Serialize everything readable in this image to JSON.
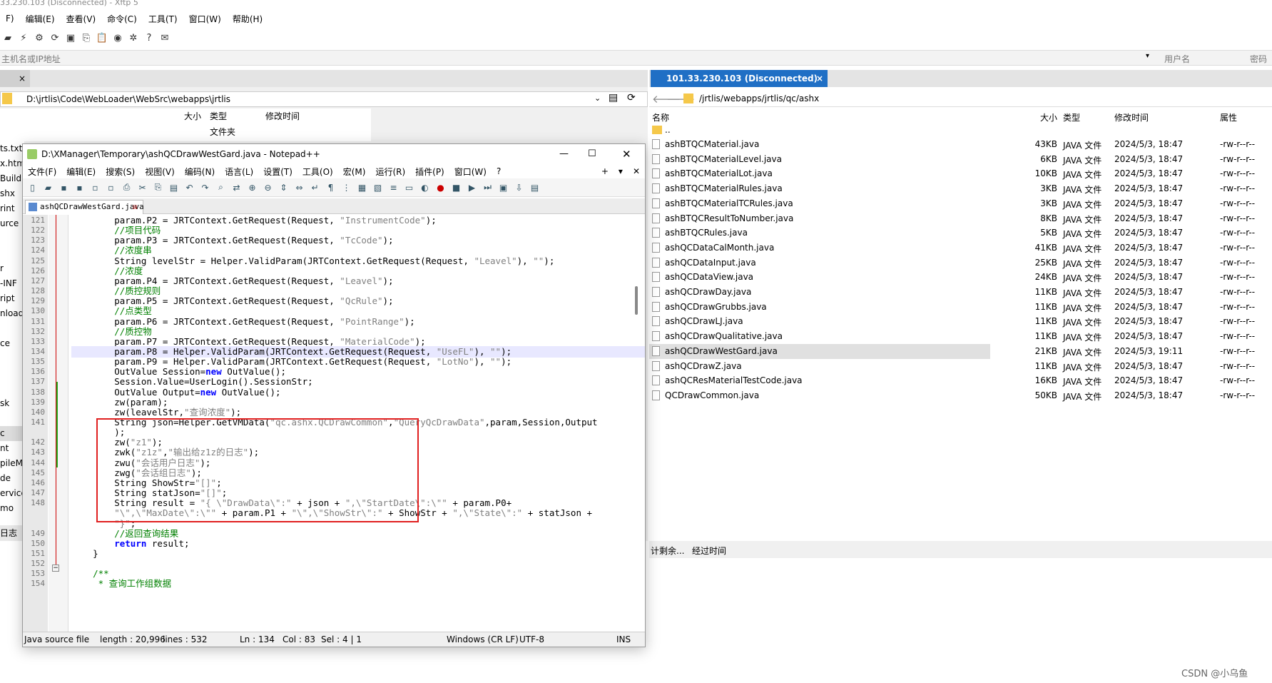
{
  "app": {
    "title": "33.230.103 (Disconnected)    - Xftp 5"
  },
  "menu": [
    "F)",
    "编辑(E)",
    "查看(V)",
    "命令(C)",
    "工具(T)",
    "窗口(W)",
    "帮助(H)"
  ],
  "addr": {
    "host_placeholder": "主机名或IP地址",
    "user_label": "用户名",
    "pass_label": "密码"
  },
  "left": {
    "path": "D:\\jrtlis\\Code\\WebLoader\\WebSrc\\webapps\\jrtlis",
    "col_size": "大小",
    "col_type": "类型",
    "col_time": "修改时间",
    "first_type": "文件夹",
    "items": [
      "ts.txt",
      "x.html",
      "Build",
      "shx",
      "rint",
      "urce",
      "",
      "",
      "r",
      "-INF",
      "ript",
      "nload",
      "",
      "ce",
      "",
      "",
      "",
      "sk",
      "",
      "c",
      "nt",
      "pileM",
      "de",
      "ervice",
      "mo"
    ],
    "footer_label": "日志"
  },
  "right": {
    "tab": "101.33.230.103 (Disconnected)",
    "path": "/jrtlis/webapps/jrtlis/qc/ashx",
    "col_name": "名称",
    "col_size": "大小",
    "col_type": "类型",
    "col_time": "修改时间",
    "col_attr": "属性",
    "up": "..",
    "files": [
      {
        "name": "ashBTQCMaterial.java",
        "size": "43KB",
        "type": "JAVA 文件",
        "time": "2024/5/3, 18:47",
        "attr": "-rw-r--r--"
      },
      {
        "name": "ashBTQCMaterialLevel.java",
        "size": "6KB",
        "type": "JAVA 文件",
        "time": "2024/5/3, 18:47",
        "attr": "-rw-r--r--"
      },
      {
        "name": "ashBTQCMaterialLot.java",
        "size": "10KB",
        "type": "JAVA 文件",
        "time": "2024/5/3, 18:47",
        "attr": "-rw-r--r--"
      },
      {
        "name": "ashBTQCMaterialRules.java",
        "size": "3KB",
        "type": "JAVA 文件",
        "time": "2024/5/3, 18:47",
        "attr": "-rw-r--r--"
      },
      {
        "name": "ashBTQCMaterialTCRules.java",
        "size": "3KB",
        "type": "JAVA 文件",
        "time": "2024/5/3, 18:47",
        "attr": "-rw-r--r--"
      },
      {
        "name": "ashBTQCResultToNumber.java",
        "size": "8KB",
        "type": "JAVA 文件",
        "time": "2024/5/3, 18:47",
        "attr": "-rw-r--r--"
      },
      {
        "name": "ashBTQCRules.java",
        "size": "5KB",
        "type": "JAVA 文件",
        "time": "2024/5/3, 18:47",
        "attr": "-rw-r--r--"
      },
      {
        "name": "ashQCDataCalMonth.java",
        "size": "41KB",
        "type": "JAVA 文件",
        "time": "2024/5/3, 18:47",
        "attr": "-rw-r--r--"
      },
      {
        "name": "ashQCDataInput.java",
        "size": "25KB",
        "type": "JAVA 文件",
        "time": "2024/5/3, 18:47",
        "attr": "-rw-r--r--"
      },
      {
        "name": "ashQCDataView.java",
        "size": "24KB",
        "type": "JAVA 文件",
        "time": "2024/5/3, 18:47",
        "attr": "-rw-r--r--"
      },
      {
        "name": "ashQCDrawDay.java",
        "size": "11KB",
        "type": "JAVA 文件",
        "time": "2024/5/3, 18:47",
        "attr": "-rw-r--r--"
      },
      {
        "name": "ashQCDrawGrubbs.java",
        "size": "11KB",
        "type": "JAVA 文件",
        "time": "2024/5/3, 18:47",
        "attr": "-rw-r--r--"
      },
      {
        "name": "ashQCDrawLJ.java",
        "size": "11KB",
        "type": "JAVA 文件",
        "time": "2024/5/3, 18:47",
        "attr": "-rw-r--r--"
      },
      {
        "name": "ashQCDrawQualitative.java",
        "size": "11KB",
        "type": "JAVA 文件",
        "time": "2024/5/3, 18:47",
        "attr": "-rw-r--r--"
      },
      {
        "name": "ashQCDrawWestGard.java",
        "size": "21KB",
        "type": "JAVA 文件",
        "time": "2024/5/3, 19:11",
        "attr": "-rw-r--r--",
        "selected": true
      },
      {
        "name": "ashQCDrawZ.java",
        "size": "11KB",
        "type": "JAVA 文件",
        "time": "2024/5/3, 18:47",
        "attr": "-rw-r--r--"
      },
      {
        "name": "ashQCResMaterialTestCode.java",
        "size": "16KB",
        "type": "JAVA 文件",
        "time": "2024/5/3, 18:47",
        "attr": "-rw-r--r--"
      },
      {
        "name": "QCDrawCommon.java",
        "size": "50KB",
        "type": "JAVA 文件",
        "time": "2024/5/3, 18:47",
        "attr": "-rw-r--r--"
      }
    ],
    "bottom_tabs": [
      "计剩余...",
      "经过时间"
    ]
  },
  "notepad": {
    "title": "D:\\XManager\\Temporary\\ashQCDrawWestGard.java - Notepad++",
    "menu": [
      "文件(F)",
      "编辑(E)",
      "搜索(S)",
      "视图(V)",
      "编码(N)",
      "语言(L)",
      "设置(T)",
      "工具(O)",
      "宏(M)",
      "运行(R)",
      "插件(P)",
      "窗口(W)",
      "?"
    ],
    "tab": "ashQCDrawWestGard.java",
    "status": {
      "type": "Java source file",
      "length": "length : 20,996",
      "lines": "lines : 532",
      "ln": "Ln : 134",
      "col": "Col : 83",
      "sel": "Sel : 4 | 1",
      "eol": "Windows (CR LF)",
      "enc": "UTF-8",
      "ins": "INS"
    },
    "lines": [
      {
        "n": "121",
        "t": "        param.P2 = JRTContext.GetRequest(Request, \"InstrumentCode\");"
      },
      {
        "n": "122",
        "t": "        //项目代码",
        "c": "cm"
      },
      {
        "n": "123",
        "t": "        param.P3 = JRTContext.GetRequest(Request, \"TcCode\");"
      },
      {
        "n": "124",
        "t": "        //浓度串",
        "c": "cm"
      },
      {
        "n": "125",
        "t": "        String levelStr = Helper.ValidParam(JRTContext.GetRequest(Request, \"Leavel\"), \"\");"
      },
      {
        "n": "126",
        "t": "        //浓度",
        "c": "cm"
      },
      {
        "n": "127",
        "t": "        param.P4 = JRTContext.GetRequest(Request, \"Leavel\");"
      },
      {
        "n": "128",
        "t": "        //质控规则",
        "c": "cm"
      },
      {
        "n": "129",
        "t": "        param.P5 = JRTContext.GetRequest(Request, \"QcRule\");"
      },
      {
        "n": "130",
        "t": "        //点类型",
        "c": "cm"
      },
      {
        "n": "131",
        "t": "        param.P6 = JRTContext.GetRequest(Request, \"PointRange\");"
      },
      {
        "n": "132",
        "t": "        //质控物",
        "c": "cm"
      },
      {
        "n": "133",
        "t": "        param.P7 = JRTContext.GetRequest(Request, \"MaterialCode\");"
      },
      {
        "n": "134",
        "t": "        param.P8 = Helper.ValidParam(JRTContext.GetRequest(Request, \"UseFL\"), \"\");",
        "c": "hl"
      },
      {
        "n": "135",
        "t": "        param.P9 = Helper.ValidParam(JRTContext.GetRequest(Request, \"LotNo\"), \"\");"
      },
      {
        "n": "136",
        "t": "        OutValue Session=new OutValue();"
      },
      {
        "n": "137",
        "t": "        Session.Value=UserLogin().SessionStr;"
      },
      {
        "n": "138",
        "t": "        OutValue Output=new OutValue();"
      },
      {
        "n": "139",
        "t": "        zw(param);"
      },
      {
        "n": "140",
        "t": "        zw(leavelStr,\"查询浓度\");"
      },
      {
        "n": "141",
        "t": "        String json=Helper.GetVMData(\"qc.ashx.QCDrawCommon\",\"QueryQcDrawData\",param,Session,Output"
      },
      {
        "n": "",
        "t": "        );"
      },
      {
        "n": "142",
        "t": "        zw(\"z1\");"
      },
      {
        "n": "143",
        "t": "        zwk(\"z1z\",\"输出给z1z的日志\");"
      },
      {
        "n": "144",
        "t": "        zwu(\"会话用户日志\");"
      },
      {
        "n": "145",
        "t": "        zwg(\"会话组日志\");"
      },
      {
        "n": "146",
        "t": "        String ShowStr=\"[]\";"
      },
      {
        "n": "147",
        "t": "        String statJson=\"[]\";"
      },
      {
        "n": "148",
        "t": "        String result = \"{ \\\"DrawData\\\":\" + json + \",\\\"StartDate\\\":\\\"\" + param.P0+"
      },
      {
        "n": "",
        "t": "        \"\\\",\\\"MaxDate\\\":\\\"\" + param.P1 + \"\\\",\\\"ShowStr\\\":\" + ShowStr + \",\\\"State\\\":\" + statJson +"
      },
      {
        "n": "",
        "t": "        \"}\";"
      },
      {
        "n": "149",
        "t": "        //返回查询结果",
        "c": "cm"
      },
      {
        "n": "150",
        "t": "        return result;"
      },
      {
        "n": "151",
        "t": "    }"
      },
      {
        "n": "152",
        "t": ""
      },
      {
        "n": "153",
        "t": "    /**",
        "c": "cm"
      },
      {
        "n": "154",
        "t": "     * 查询工作组数据",
        "c": "cm"
      }
    ]
  },
  "watermark": "CSDN @小乌鱼"
}
